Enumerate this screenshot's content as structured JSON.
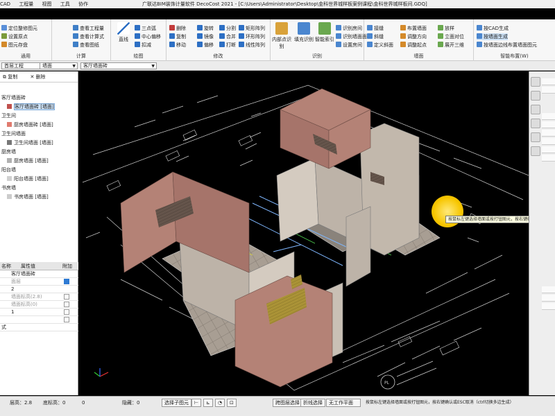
{
  "titlebar": {
    "title": "广联达BIM装饰计量软件 DecoCost 2021 - [C:\\Users\\Administrator\\Desktop\\金科世界城样板案例课程\\金科世界城样板间.GDQ]",
    "menus": [
      "CAD",
      "工程量",
      "视图",
      "工具",
      "协作"
    ]
  },
  "ribbon": {
    "groups": [
      {
        "label": "通用",
        "items": [
          "定位整修图元",
          "设置原点",
          "图元存盘"
        ]
      },
      {
        "label": "计算",
        "items": [
          "查看工程量",
          "查看计算式",
          "查看图纸"
        ]
      },
      {
        "label": "绘图",
        "items": [
          "直线",
          "三点弧",
          "中心偏移",
          "扣减"
        ]
      },
      {
        "label": "修改",
        "items": [
          "删除",
          "复制",
          "移动",
          "旋转",
          "镜像",
          "偏移",
          "分割",
          "合并",
          "打断",
          "矩形阵列",
          "环形阵列",
          "线性阵列"
        ]
      },
      {
        "label": "识别",
        "items": [
          "内部点识别",
          "填充识别",
          "智能索引",
          "识别房间",
          "识别墙面面层",
          "设置房间"
        ]
      },
      {
        "label": "墙面",
        "items": [
          "接缝",
          "斜缝",
          "定义斜面",
          "布置墙面",
          "调整方向",
          "调整起点",
          "放样",
          "立面对位",
          "展开三维"
        ]
      },
      {
        "label": "智能布置(W)",
        "items": [
          "按CAD生成",
          "按墙面生成",
          "按墙面边线布置墙面图元"
        ]
      }
    ],
    "title_group_1": "计算",
    "title_group_2": "绘图"
  },
  "selectors": {
    "floor": "首层工程",
    "category": "墙面",
    "element": "客厅墙面砖"
  },
  "left_panel": {
    "toolbar": [
      "复制",
      "删除"
    ],
    "tree": [
      {
        "label": "客厅墙面砖",
        "child": false
      },
      {
        "label": "客厅墙面砖 [墙面]",
        "child": true,
        "selected": true,
        "color": "#c0504d"
      },
      {
        "label": "卫生间",
        "child": false
      },
      {
        "label": "厨房墙面砖 [墙面]",
        "child": true,
        "color": "#e07a6e"
      },
      {
        "label": "卫生间墙面",
        "child": false
      },
      {
        "label": "卫生间墙面 [墙面]",
        "child": true,
        "color": "#777777"
      },
      {
        "label": "厨房墙",
        "child": false
      },
      {
        "label": "厨房墙面 [墙面]",
        "child": true,
        "color": "#b0b0b0"
      },
      {
        "label": "阳台墙",
        "child": false
      },
      {
        "label": "阳台墙面 [墙面]",
        "child": true,
        "color": "#d0d0d0"
      },
      {
        "label": "书房墙",
        "child": false
      },
      {
        "label": "书房墙面 [墙面]",
        "child": true,
        "color": "#cccccc"
      }
    ],
    "props_headers": [
      "名称",
      "属性值",
      "附加"
    ],
    "props": [
      {
        "name": "",
        "value": "客厅墙面砖",
        "dim": false,
        "check": null
      },
      {
        "name": "",
        "value": "面层",
        "dim": true,
        "check": true
      },
      {
        "name": "",
        "value": "2",
        "dim": false,
        "check": null
      },
      {
        "name": "",
        "value": "墙面标高(2.8)",
        "dim": true,
        "check": false
      },
      {
        "name": "",
        "value": "墙面标高(0)",
        "dim": true,
        "check": false
      },
      {
        "name": "",
        "value": "1",
        "dim": false,
        "check": false
      },
      {
        "name": "",
        "value": "",
        "dim": false,
        "check": false
      },
      {
        "name": "式",
        "value": "",
        "dim": false,
        "check": null
      }
    ]
  },
  "viewport": {
    "tooltip": "按鼠标左键选择墙面或按打钮图元，按右键确认或ESC取消"
  },
  "statusbar": {
    "height_label": "层高：2.8",
    "bottom_label": "底标高：0",
    "zero_label": "0",
    "hidden_label": "隐藏：0",
    "buttons": [
      "选择子图元",
      "跨图层选择",
      "折线选择",
      "无工作平面"
    ],
    "hint": "按鼠标左键选择墙面或按打钮图元，按右键确认或ESC取消（ctrl切换多边生成）"
  },
  "colors": {
    "wall_pink": "#b48276",
    "wall_gray": "#bdb3a8",
    "cad_lines": "#cfcfcf",
    "highlight": "#f7c600"
  }
}
